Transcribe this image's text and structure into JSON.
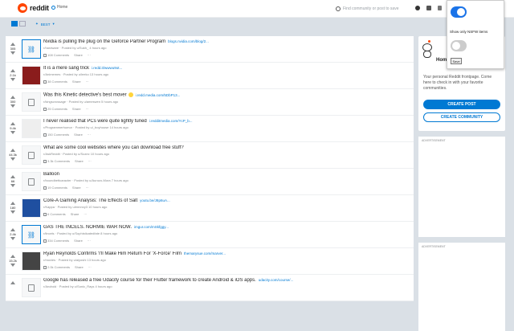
{
  "header": {
    "logo_text": "reddit",
    "home_label": "Home",
    "search_placeholder": "Find community or post to save"
  },
  "sortbar": {
    "sort_label": "BEST"
  },
  "posts": [
    {
      "votes": "305",
      "title": "Nvidia is pulling the plug on the Geforce Partner Program",
      "domain": "blogs.nvidia.com/blog/2...",
      "meta": "r/hardware · Posted by u/Sukh_ 4 hours ago",
      "comments": "108 Comments",
      "share": "Share"
    },
    {
      "votes": "2.1k",
      "title": "It is a mere sang trick",
      "domain": "i.redd.it/wwwu9ot...",
      "meta": "r/Animemes · Posted by u/leeko 13 hours ago",
      "comments": "38 Comments",
      "share": "Share"
    },
    {
      "votes": "300",
      "title": "Was this Kinetic detective's best mover",
      "domain": "i.redd.media.com/5DbP13...",
      "meta": "r/kingscrossage · Posted by u/ameswen 5 hours ago",
      "comments": "25 Comments",
      "share": "Share"
    },
    {
      "votes": "9.4k",
      "title": "I never realised that PCs were quite lightly tuned",
      "domain": "i.redditmedia.com/YcP_b...",
      "meta": "r/Programmerhumor · Posted by u/_boyhouse 14 hours ago",
      "comments": "150 Comments",
      "share": "Share"
    },
    {
      "votes": "44.3k",
      "title": "What are some cool websites where you can download free stuff?",
      "domain": "",
      "meta": "r/AskReddit · Posted by u/Sozez 10 hours ago",
      "comments": "3.3k Comments",
      "share": "Share"
    },
    {
      "votes": "66",
      "title": "Balloon",
      "domain": "",
      "meta": "r/boundbettcaracter · Posted by u/Aurozo-Mora 7 hours ago",
      "comments": "19 Comments",
      "share": "Share"
    },
    {
      "votes": "180",
      "title": "Core-A Gaming Analysis: The Effects of Salt",
      "domain": "youtu.be/J8p6uA...",
      "meta": "r/Kappa · Posted by u/ennnvy3 10 hours ago",
      "comments": "6 Comments",
      "share": "Share"
    },
    {
      "votes": "2.4k",
      "title": "GAS THE INCELS. NORMIE WAR NOW.",
      "domain": "imgur.com/mSkfggy...",
      "meta": "r/iincels · Posted by u/Sophisticatedfate 8 hours ago",
      "comments": "334 Comments",
      "share": "Share"
    },
    {
      "votes": "15.2k",
      "title": "Ryan Reynolds Confirms 'I'll Make Him Return For 'X-Force' Film",
      "domain": "themarysue.com/marver...",
      "meta": "r/movies · Posted by u/aiyoshi 13 hours ago",
      "comments": "2.0k Comments",
      "share": "Share"
    },
    {
      "votes": "",
      "title": "Google has released a free Udacity course for their Flutter framework to create Android & iOS apps.",
      "domain": "udacity.com/course/...",
      "meta": "r/Android · Posted by u/Sonic_Rays 4 hours ago",
      "comments": "",
      "share": ""
    }
  ],
  "sidebar": {
    "home_title": "Home",
    "home_desc": "Your personal Reddit frontpage. Come here to check in with your favorite communities.",
    "create_post": "CREATE POST",
    "create_community": "CREATE COMMUNITY",
    "ad_label_1": "ADVERTISEMENT",
    "ad_label_2": "ADVERTISEMENT"
  },
  "popup": {
    "toggle1_on": true,
    "label": "Show only NSFW items",
    "toggle2_on": false,
    "save": "Save"
  },
  "colors": {
    "brand": "#ff4500",
    "accent": "#0079d3",
    "toggle": "#1a73e8"
  }
}
